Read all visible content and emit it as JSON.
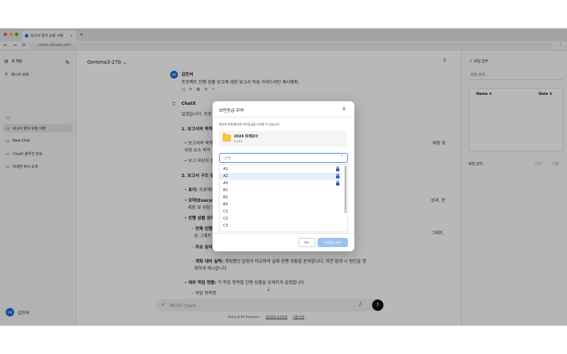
{
  "browser": {
    "tab_title": "보고서 양식 요청 사항",
    "url": "chatx.ulinnex.com",
    "tab_close": "×",
    "tab_new": "+",
    "nav_back": "←",
    "nav_forward": "→",
    "nav_reload": "⟳",
    "menu": "⋮",
    "traffic_colors": [
      "#ff5f57",
      "#febc2e",
      "#28c840"
    ]
  },
  "sidebar": {
    "new_chat": "새 채팅",
    "search": "메시지 검색",
    "section_label": "무도",
    "items": [
      {
        "label": "보고서 양식 요청 사항",
        "active": true
      },
      {
        "label": "New Chat",
        "active": false
      },
      {
        "label": "ChatX 솔루션 안내",
        "active": false
      },
      {
        "label": "비대면 회사 소개",
        "active": false
      }
    ],
    "more": "···",
    "user_initials": "KM",
    "user_name": "김민석"
  },
  "main": {
    "model": "Gemma3-27b ⌄",
    "user_initials": "KM",
    "user_name": "김민석",
    "user_message": "프로젝트 진행 상황 보고에 대한 보고서 작성 가이드라인 제시해줘.",
    "bot_name": "ChatX",
    "bot_lines": [
      {
        "pre": "",
        "bold": "",
        "text": "알겠습니다. 프로"
      },
      {
        "pre": "",
        "bold": "1. 보고서의 목적",
        "text": ""
      },
      {
        "pre": "• ",
        "bold": "",
        "text": "보고서의 목적"
      },
      {
        "pre": "",
        "bold": "",
        "text": "위험 요소 파악"
      },
      {
        "pre": "• ",
        "bold": "",
        "text": "보고 대상자 분"
      },
      {
        "pre": "",
        "bold": "2. 보고서 구조 및",
        "text": ""
      },
      {
        "pre": "• ",
        "bold": "표지:",
        "text": " 프로젝트"
      },
      {
        "pre": "• ",
        "bold": "요약(Executi",
        "text": ""
      },
      {
        "pre": "",
        "bold": "",
        "text": "제점 및 위험 요"
      },
      {
        "pre": "• ",
        "bold": "진행 상황 요약",
        "text": ""
      },
      {
        "pre": "◦ ",
        "bold": "전체 진행",
        "text": ""
      },
      {
        "pre": "",
        "bold": "",
        "text": "등 그래프"
      },
      {
        "pre": "◦ ",
        "bold": "주요 성과",
        "text": ""
      },
      {
        "pre": "◦ ",
        "bold": "계획 대비 실적:",
        "text": " 계획했던 일정과 비교하여 실제 진행 상황을 분석합니다. 지연 발생 시 원인을 명"
      },
      {
        "pre": "",
        "bold": "",
        "text": "확하게 제시합니다."
      },
      {
        "pre": "• ",
        "bold": "세부 작업 현황:",
        "text": " 각 작업 항목별 진행 상황을 상세하게 설명합니다."
      },
      {
        "pre": "◦ ",
        "bold": "",
        "text": "작업 항목명"
      }
    ],
    "bot_right_fragments": [
      "재점 및",
      "성과, 문",
      "그래프,"
    ],
    "input_placeholder": "메시지 ChatX",
    "footer_text": "Every AI for Everyone.",
    "footer_link1": "개인정보 보호정책",
    "footer_link2": "이용 약관"
  },
  "right_panel": {
    "title": "파일 업무",
    "search_placeholder": "파일 검색...",
    "col_name": "Name ⇅",
    "col_date": "Date ⇅",
    "manage": "파일 관리",
    "prev": "이전",
    "next": "다음"
  },
  "modal": {
    "title": "보안등급 부여",
    "close": "×",
    "description": "첨부한 파일/폴더에 보안등급을 부여할 수 있습니다.",
    "folder_name": "2024 회계감사",
    "folder_type": "Folder",
    "select_placeholder": "선택",
    "select_chevron": "⌃",
    "options": [
      {
        "label": "A1",
        "locked": true,
        "selected": false
      },
      {
        "label": "A2",
        "locked": true,
        "selected": true
      },
      {
        "label": "A3",
        "locked": true,
        "selected": false
      },
      {
        "label": "B1",
        "locked": false,
        "selected": false
      },
      {
        "label": "B2",
        "locked": false,
        "selected": false
      },
      {
        "label": "B3",
        "locked": false,
        "selected": false
      },
      {
        "label": "C1",
        "locked": false,
        "selected": false
      },
      {
        "label": "C2",
        "locked": false,
        "selected": false
      },
      {
        "label": "C3",
        "locked": false,
        "selected": false
      }
    ],
    "cancel": "취소",
    "confirm": "보안등급 부여"
  },
  "colors": {
    "accent": "#1e6bd6",
    "confirm_disabled": "#9cc3f0",
    "folder": "#f5c443",
    "lock": "#2d5fa8"
  }
}
